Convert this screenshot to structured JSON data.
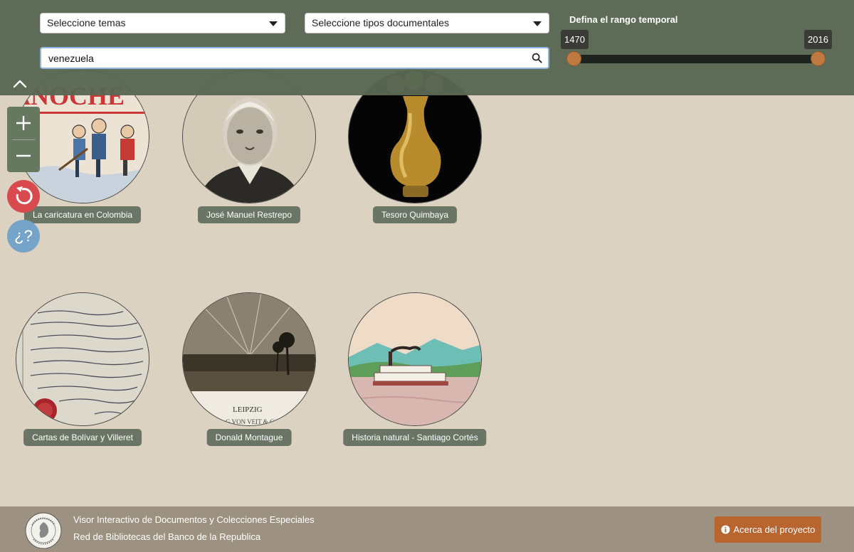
{
  "filters": {
    "topics_placeholder": "Seleccione temas",
    "doc_types_placeholder": "Seleccione tipos documentales",
    "search_value": "venezuela",
    "range": {
      "title": "Defina el rango temporal",
      "min": "1470",
      "max": "2016"
    }
  },
  "controls": {
    "zoom_in_icon": "plus-icon",
    "zoom_out_icon": "minus-icon",
    "reset_icon": "refresh-icon",
    "help_label": "¿?"
  },
  "collections": [
    {
      "label": "La caricatura en Colombia",
      "image": "caricature-illustration"
    },
    {
      "label": "José Manuel Restrepo",
      "image": "portrait-engraving"
    },
    {
      "label": "Tesoro Quimbaya",
      "image": "gold-vessel-photo"
    },
    {
      "label": "Cartas de Bolívar y Villeret",
      "image": "handwritten-letter"
    },
    {
      "label": "Donald Montague",
      "image": "landscape-engraving"
    },
    {
      "label": "Historia natural - Santiago Cortés",
      "image": "steamboat-watercolor"
    }
  ],
  "footer": {
    "line1": "Visor Interactivo de Documentos y Colecciones Especiales",
    "line2": "Red de Bibliotecas del Banco de la Republica",
    "about_label": "Acerca del proyecto",
    "logo": "banco-de-la-republica-seal"
  },
  "colors": {
    "topbar": "#586752",
    "background": "#dcd2c1",
    "accent": "#c07a3f",
    "reset": "#d94a4f",
    "help": "#76a3c8",
    "footer": "#9d9281",
    "about_button": "#b8652f"
  }
}
